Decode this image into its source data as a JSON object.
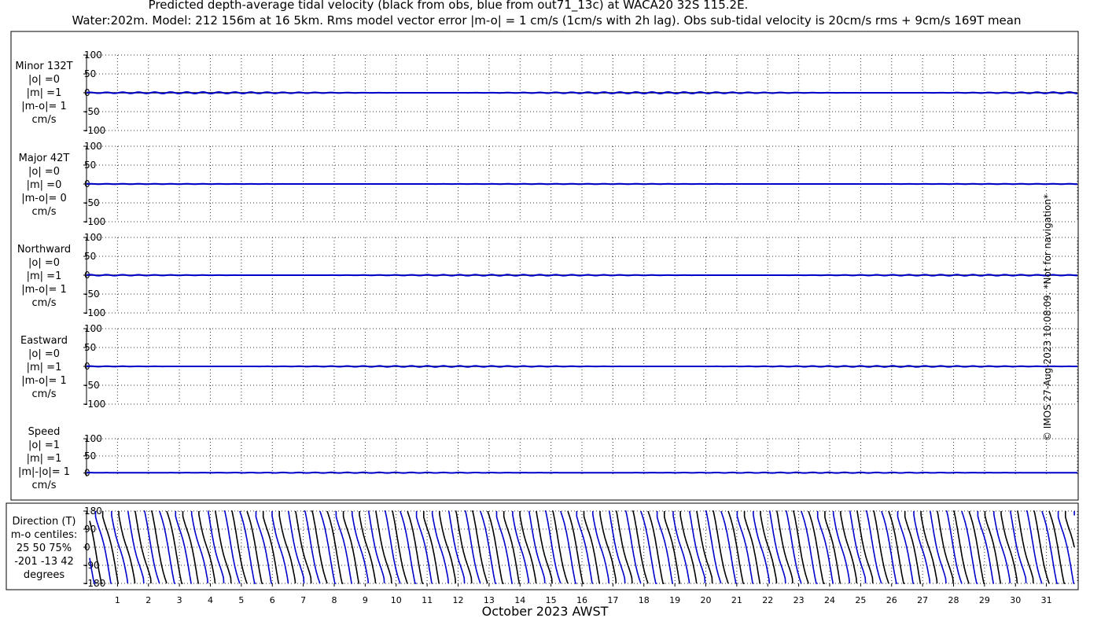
{
  "title_line1": "Predicted depth-average tidal velocity (black from obs, blue from out71_13c) at WACA20 32S 115.2E.",
  "title_line2": "Water:202m. Model: 212 156m at 16 5km. Rms model vector error |m-o| = 1 cm/s (1cm/s with 2h lag). Obs sub-tidal velocity is 20cm/s rms + 9cm/s 169T mean",
  "credit": "© IMOS 27-Aug-2023 10:08:09. *Not for navigation*",
  "colors": {
    "obs": "#000000",
    "model": "#0000cc",
    "grid": "#333333"
  },
  "chart_data": {
    "type": "line",
    "xlabel": "October 2023 AWST",
    "x_ticks": [
      "1",
      "2",
      "3",
      "4",
      "5",
      "6",
      "7",
      "8",
      "9",
      "10",
      "11",
      "12",
      "13",
      "14",
      "15",
      "16",
      "17",
      "18",
      "19",
      "20",
      "21",
      "22",
      "23",
      "24",
      "25",
      "26",
      "27",
      "28",
      "29",
      "30",
      "31"
    ],
    "xlim": [
      0,
      32
    ],
    "series_colors": {
      "black": "obs",
      "blue": "model"
    },
    "panels": [
      {
        "id": "minor",
        "label_lines": [
          "Minor 132T",
          "|o| =0",
          "|m| =1",
          "|m-o|= 1",
          "cm/s"
        ],
        "ylim": [
          -100,
          100
        ],
        "y_ticks": [
          "100",
          "50",
          "0",
          "-50",
          "-100"
        ],
        "obs_level": 0,
        "model_level": 0,
        "model_ripple": 2
      },
      {
        "id": "major",
        "label_lines": [
          "Major 42T",
          "|o| =0",
          "|m| =0",
          "|m-o|= 0",
          "cm/s"
        ],
        "ylim": [
          -100,
          100
        ],
        "y_ticks": [
          "100",
          "50",
          "0",
          "-50",
          "-100"
        ],
        "obs_level": 0,
        "model_level": 0,
        "model_ripple": 0.6
      },
      {
        "id": "north",
        "label_lines": [
          "Northward",
          "|o| =0",
          "|m| =1",
          "|m-o|= 1",
          "cm/s"
        ],
        "ylim": [
          -100,
          100
        ],
        "y_ticks": [
          "100",
          "50",
          "0",
          "-50",
          "-100"
        ],
        "obs_level": 0,
        "model_level": 0,
        "model_ripple": 1.5
      },
      {
        "id": "east",
        "label_lines": [
          "Eastward",
          "|o| =0",
          "|m| =1",
          "|m-o|= 1",
          "cm/s"
        ],
        "ylim": [
          -100,
          100
        ],
        "y_ticks": [
          "100",
          "50",
          "0",
          "-50",
          "-100"
        ],
        "obs_level": 0,
        "model_level": 0,
        "model_ripple": 1.5
      },
      {
        "id": "speed",
        "label_lines": [
          "Speed",
          "|o| =1",
          "|m| =1",
          "|m|-|o|= 1",
          "cm/s"
        ],
        "ylim": [
          -10,
          100
        ],
        "y_ticks": [
          "100",
          "50",
          "0"
        ],
        "obs_level": 1,
        "model_level": 1,
        "model_ripple": 1
      }
    ],
    "direction_panel": {
      "label_lines": [
        "Direction (T)",
        "m-o centiles:",
        "25  50  75%",
        "-201  -13   42",
        "degrees"
      ],
      "ylim": [
        -180,
        180
      ],
      "y_ticks": [
        "180",
        "90",
        "0",
        "-90",
        "-180"
      ],
      "cycles_per_day": 1.93,
      "obs_phase": 0.0,
      "model_phase": 0.45
    }
  }
}
